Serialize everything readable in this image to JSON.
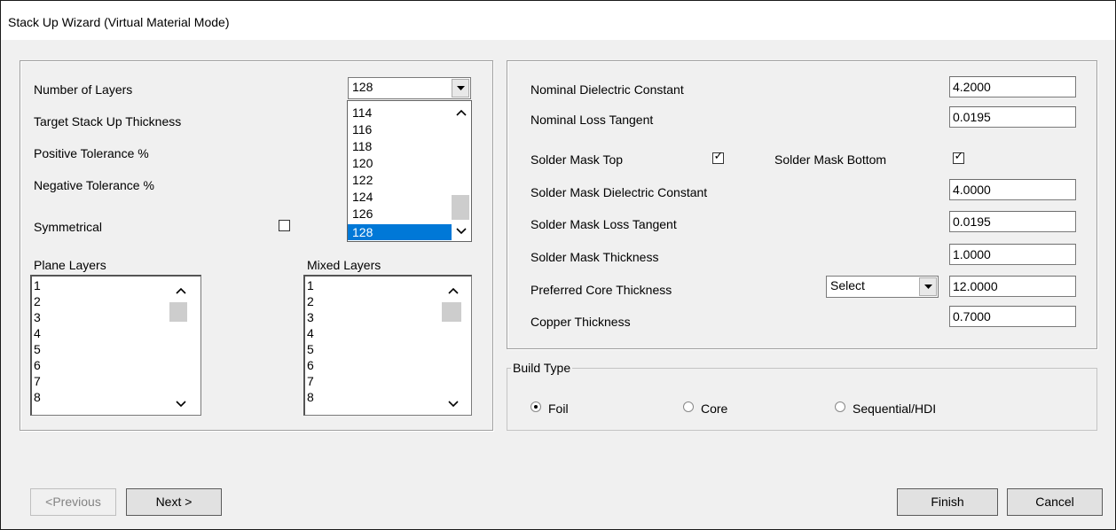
{
  "window": {
    "title": "Stack Up Wizard (Virtual Material Mode)"
  },
  "left_panel": {
    "number_of_layers_label": "Number of Layers",
    "target_thickness_label": "Target Stack Up Thickness",
    "positive_tolerance_label": "Positive Tolerance %",
    "negative_tolerance_label": "Negative Tolerance %",
    "symmetrical_label": "Symmetrical",
    "symmetrical_checked": false,
    "layers_combo_value": "128",
    "layers_options": [
      "114",
      "116",
      "118",
      "120",
      "122",
      "124",
      "126",
      "128"
    ],
    "layers_selected": "128",
    "plane_layers_label": "Plane Layers",
    "plane_layers_items": [
      "1",
      "2",
      "3",
      "4",
      "5",
      "6",
      "7",
      "8"
    ],
    "mixed_layers_label": "Mixed Layers",
    "mixed_layers_items": [
      "1",
      "2",
      "3",
      "4",
      "5",
      "6",
      "7",
      "8"
    ]
  },
  "right_panel": {
    "nominal_dielectric_label": "Nominal Dielectric Constant",
    "nominal_dielectric_value": "4.2000",
    "nominal_loss_label": "Nominal Loss Tangent",
    "nominal_loss_value": "0.0195",
    "solder_mask_top_label": "Solder Mask Top",
    "solder_mask_top_checked": true,
    "solder_mask_bottom_label": "Solder Mask Bottom",
    "solder_mask_bottom_checked": true,
    "sm_dielectric_label": "Solder Mask Dielectric Constant",
    "sm_dielectric_value": "4.0000",
    "sm_loss_label": "Solder Mask Loss Tangent",
    "sm_loss_value": "0.0195",
    "sm_thickness_label": "Solder Mask Thickness",
    "sm_thickness_value": "1.0000",
    "core_thickness_label": "Preferred Core Thickness",
    "core_select_value": "Select",
    "core_thickness_value": "12.0000",
    "copper_thickness_label": "Copper Thickness",
    "copper_thickness_value": "0.7000"
  },
  "build_type": {
    "legend": "Build Type",
    "options": [
      "Foil",
      "Core",
      "Sequential/HDI"
    ],
    "selected": "Foil"
  },
  "buttons": {
    "previous": "<Previous",
    "next": "Next >",
    "finish": "Finish",
    "cancel": "Cancel"
  },
  "checkmark_glyph": "✓"
}
